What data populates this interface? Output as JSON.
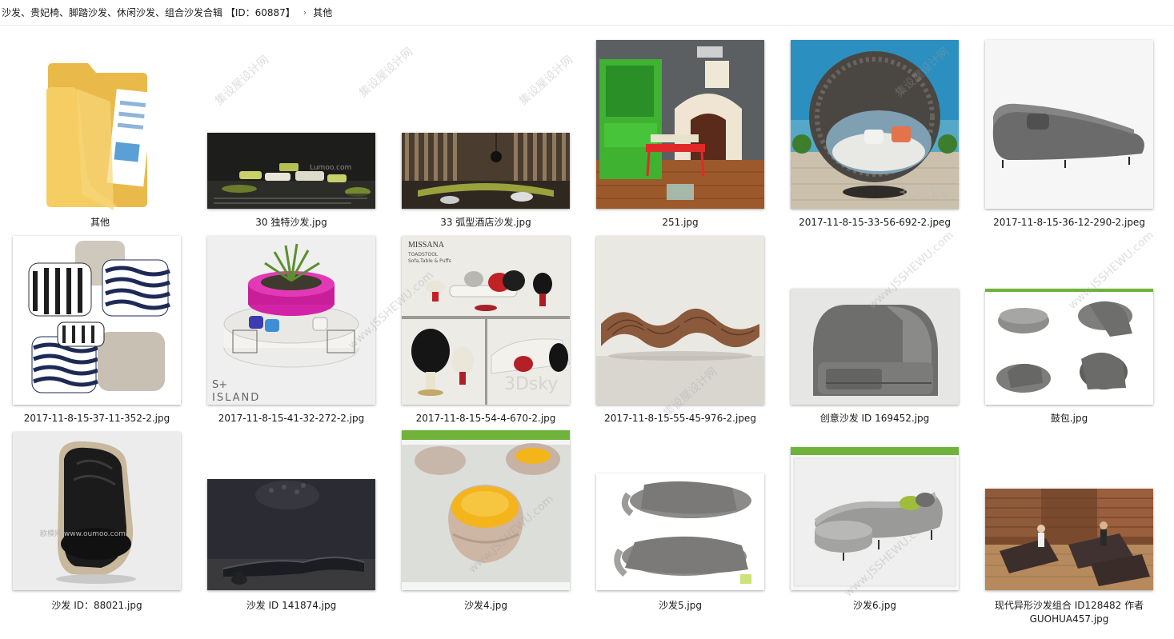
{
  "breadcrumb": {
    "path": "沙发、贵妃椅、脚踏沙发、休闲沙发、组合沙发合辑 【ID：60887】",
    "current": "其他"
  },
  "files": [
    {
      "name": "其他",
      "type": "folder-icon"
    },
    {
      "name": "30 独特沙发.jpg"
    },
    {
      "name": "33 弧型酒店沙发.jpg"
    },
    {
      "name": "251.jpg"
    },
    {
      "name": "2017-11-8-15-33-56-692-2.jpeg"
    },
    {
      "name": "2017-11-8-15-36-12-290-2.jpeg"
    },
    {
      "name": "2017-11-8-15-37-11-352-2.jpg"
    },
    {
      "name": "2017-11-8-15-41-32-272-2.jpg"
    },
    {
      "name": "2017-11-8-15-54-4-670-2.jpg"
    },
    {
      "name": "2017-11-8-15-55-45-976-2.jpeg"
    },
    {
      "name": "创意沙发 ID 169452.jpg"
    },
    {
      "name": "鼓包.jpg"
    },
    {
      "name": "沙发 ID：88021.jpg"
    },
    {
      "name": "沙发 ID 141874.jpg"
    },
    {
      "name": "沙发4.jpg"
    },
    {
      "name": "沙发5.jpg"
    },
    {
      "name": "沙发6.jpg"
    },
    {
      "name": "现代异形沙发组合 ID128482 作者 GUOHUA457.jpg"
    }
  ],
  "thumb_text": {
    "t1": "Lumoo.com",
    "t7a": "S+",
    "t7b": "ISLAND",
    "t8a": "MISSANA",
    "t8b": "TOADSTOOL",
    "t8c": "Sofa,Table & Puffs",
    "t12": "欧模网 www.oumoo.com"
  },
  "watermarks": [
    "集设屋设计网",
    "www.JSSHEWU.com",
    "3Dsky"
  ],
  "colors": {
    "accent": "#0078d7",
    "folder": "#f5cd62",
    "folder_dark": "#e9b949"
  }
}
